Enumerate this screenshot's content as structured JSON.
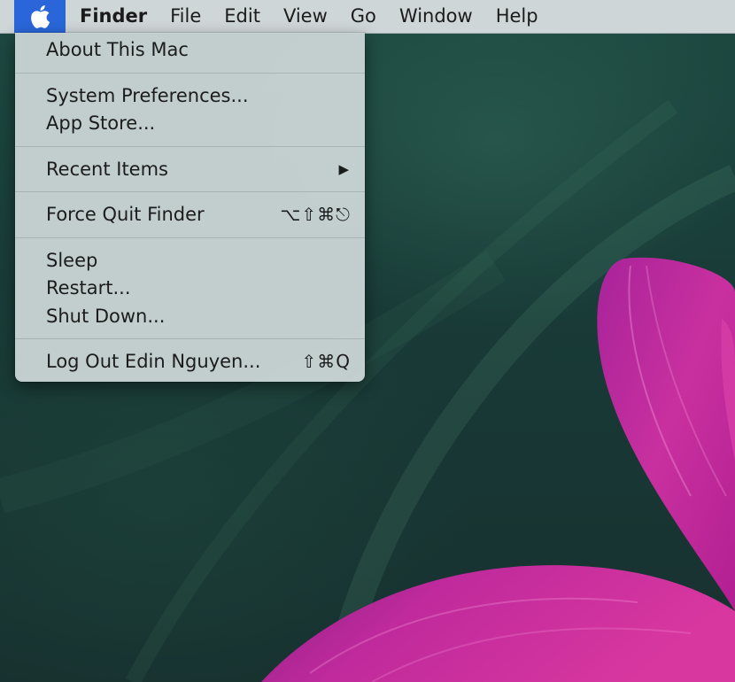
{
  "menubar": {
    "apple_icon": "apple-logo",
    "items": [
      "Finder",
      "File",
      "Edit",
      "View",
      "Go",
      "Window",
      "Help"
    ]
  },
  "apple_menu": {
    "about": "About This Mac",
    "system_preferences": "System Preferences...",
    "app_store": "App Store...",
    "recent_items": "Recent Items",
    "force_quit": "Force Quit Finder",
    "force_quit_shortcut": "⌥⇧⌘⎋",
    "sleep": "Sleep",
    "restart": "Restart...",
    "shut_down": "Shut Down...",
    "log_out": "Log Out Edin Nguyen...",
    "log_out_shortcut": "⇧⌘Q"
  },
  "colors": {
    "menubar_bg": "#cfd6d7",
    "apple_highlight": "#2a66d9",
    "menu_bg": "#c8d3d3",
    "wallpaper_dark": "#183432",
    "petal_pink": "#c2279f"
  }
}
